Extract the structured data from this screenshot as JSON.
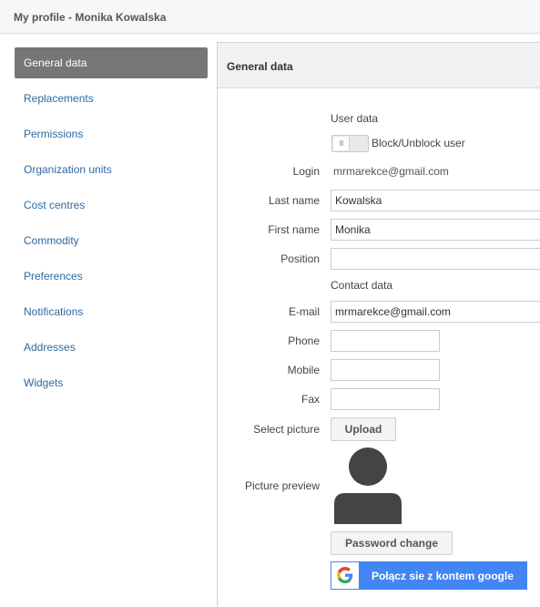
{
  "header": {
    "title": "My profile - Monika Kowalska"
  },
  "sidebar": {
    "items": [
      {
        "label": "General data",
        "active": true
      },
      {
        "label": "Replacements"
      },
      {
        "label": "Permissions"
      },
      {
        "label": "Organization units"
      },
      {
        "label": "Cost centres"
      },
      {
        "label": "Commodity"
      },
      {
        "label": "Preferences"
      },
      {
        "label": "Notifications"
      },
      {
        "label": "Addresses"
      },
      {
        "label": "Widgets"
      }
    ]
  },
  "panel": {
    "title": "General data"
  },
  "form": {
    "user_data_heading": "User data",
    "block_toggle_label": "Block/Unblock user",
    "login_label": "Login",
    "login_value": "mrmarekce@gmail.com",
    "last_name_label": "Last name",
    "last_name_value": "Kowalska",
    "first_name_label": "First name",
    "first_name_value": "Monika",
    "position_label": "Position",
    "position_value": "",
    "contact_heading": "Contact data",
    "email_label": "E-mail",
    "email_value": "mrmarekce@gmail.com",
    "phone_label": "Phone",
    "phone_value": "",
    "mobile_label": "Mobile",
    "mobile_value": "",
    "fax_label": "Fax",
    "fax_value": "",
    "select_picture_label": "Select picture",
    "upload_label": "Upload",
    "picture_preview_label": "Picture preview",
    "password_change_label": "Password change",
    "google_connect_label": "Połącz sie z kontem google"
  },
  "colors": {
    "accent_link": "#2d6a9f",
    "active_nav": "#767676",
    "google_blue": "#4285f4",
    "avatar": "#444444"
  },
  "icons": {
    "avatar": "user-silhouette-icon",
    "google": "google-g-icon",
    "toggle": "toggle-switch-icon"
  }
}
